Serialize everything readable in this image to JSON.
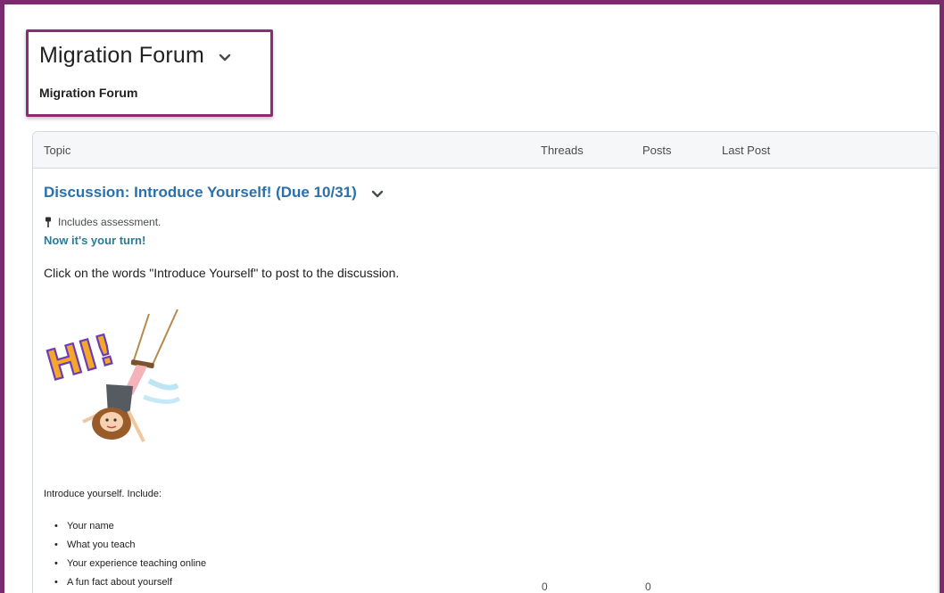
{
  "forum": {
    "title": "Migration Forum",
    "subtitle": "Migration Forum"
  },
  "table": {
    "headers": {
      "topic": "Topic",
      "threads": "Threads",
      "posts": "Posts",
      "last_post": "Last Post"
    }
  },
  "topic": {
    "title": "Discussion: Introduce Yourself! (Due 10/31)",
    "assessment_note": "Includes assessment.",
    "turn_text": "Now it's your turn!",
    "instruction": "Click on the words \"Introduce Yourself\" to post to the discussion.",
    "image_text": "HI!",
    "intro": "Introduce yourself.  Include:",
    "bullets": [
      "Your name",
      "What you teach",
      "Your experience teaching online",
      "A fun fact about yourself"
    ],
    "threads_count": "0",
    "posts_count": "0"
  },
  "colors": {
    "frame": "#7a2b6e",
    "highlight_border": "#8c2d73",
    "link": "#2b6fab"
  }
}
